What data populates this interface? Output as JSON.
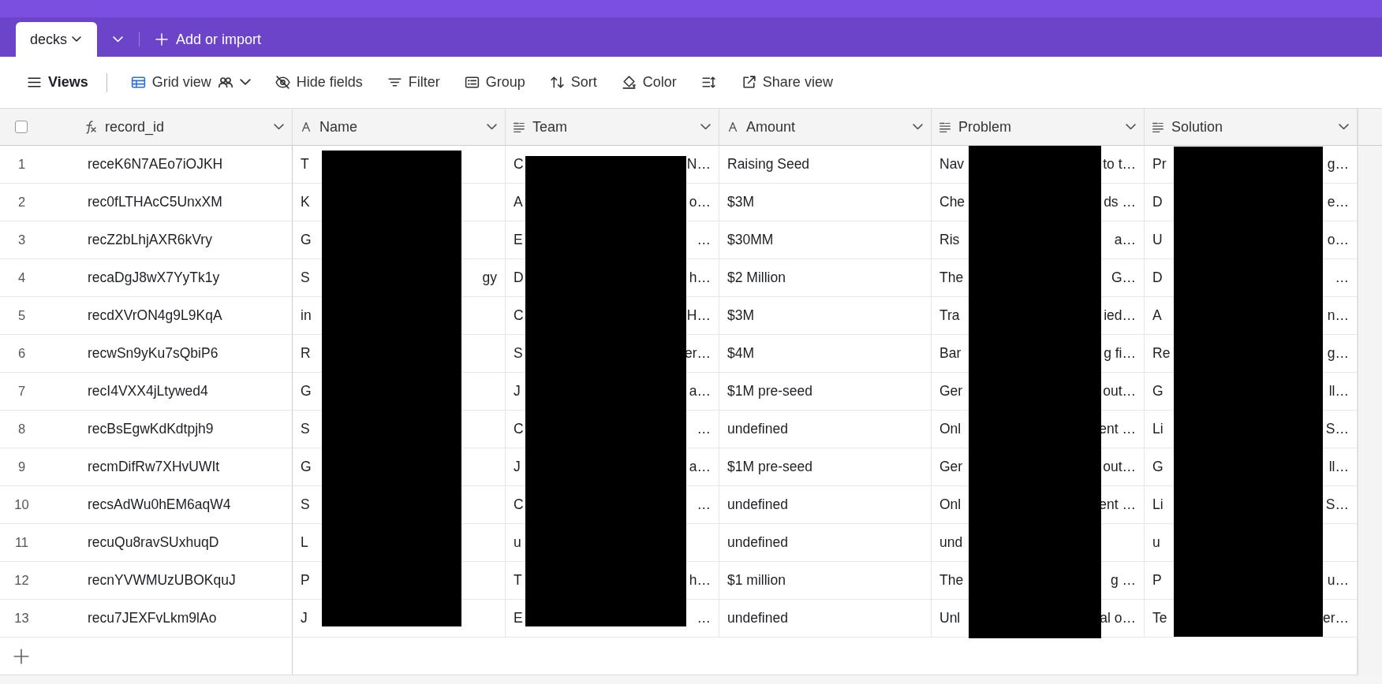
{
  "tabs": [
    {
      "label": "decks",
      "selected": true
    }
  ],
  "add_button": "Add or import",
  "toolbar": [
    {
      "label": "Views",
      "kind": "views"
    },
    {
      "label": "Grid view",
      "kind": "grid"
    },
    {
      "label": "Hide fields",
      "kind": "hide"
    },
    {
      "label": "Filter",
      "kind": "filter"
    },
    {
      "label": "Group",
      "kind": "group"
    },
    {
      "label": "Sort",
      "kind": "sort"
    },
    {
      "label": "Color",
      "kind": "color"
    },
    {
      "kind": "height"
    },
    {
      "label": "Share view",
      "kind": "share"
    }
  ],
  "table": {
    "select_all": {
      "checked": false
    },
    "columns": [
      {
        "label": "record_id",
        "kind": "formula"
      },
      {
        "label": "Name",
        "kind": "text"
      },
      {
        "label": "Team",
        "kind": "longtext"
      },
      {
        "label": "Amount",
        "kind": "text"
      },
      {
        "label": "Problem",
        "kind": "longtext"
      },
      {
        "label": "Solution",
        "kind": "longtext"
      }
    ],
    "rows": [
      {
        "number": "1",
        "record_id": "receK6N7AEo7iOJKH",
        "name": {
          "start": "T"
        },
        "team": {
          "start": "C",
          "end": "N…"
        },
        "amount": "Raising Seed",
        "problem": {
          "start": "Nav",
          "end": "to t…"
        },
        "solution": {
          "start": "Pr",
          "end": "g…"
        }
      },
      {
        "number": "2",
        "record_id": "rec0fLTHAcC5UnxXM",
        "name": {
          "start": "K"
        },
        "team": {
          "start": "A",
          "end": "o…"
        },
        "amount": "$3M",
        "problem": {
          "start": "Che",
          "end": "ds …"
        },
        "solution": {
          "start": "D",
          "end": "e…"
        }
      },
      {
        "number": "3",
        "record_id": "recZ2bLhjAXR6kVry",
        "name": {
          "start": "G"
        },
        "team": {
          "start": "E",
          "end": "…"
        },
        "amount": "$30MM",
        "problem": {
          "start": "Ris",
          "end": "a…"
        },
        "solution": {
          "start": "U",
          "end": "o…"
        }
      },
      {
        "number": "4",
        "record_id": "recaDgJ8wX7YyTk1y",
        "name": {
          "start": "S",
          "end": "gy"
        },
        "team": {
          "start": "D",
          "end": "h…"
        },
        "amount": "$2 Million",
        "problem": {
          "start": "The",
          "end": "G…"
        },
        "solution": {
          "start": "D",
          "end": "…"
        }
      },
      {
        "number": "5",
        "record_id": "recdXVrON4g9L9KqA",
        "name": {
          "start": "in"
        },
        "team": {
          "start": "C",
          "end": "H…"
        },
        "amount": "$3M",
        "problem": {
          "start": "Tra",
          "end": "ied…"
        },
        "solution": {
          "start": "A",
          "end": "n…"
        }
      },
      {
        "number": "6",
        "record_id": "recwSn9yKu7sQbiP6",
        "name": {
          "start": "R"
        },
        "team": {
          "start": "S",
          "end": "er…"
        },
        "amount": "$4M",
        "problem": {
          "start": "Bar",
          "end": "g fi…"
        },
        "solution": {
          "start": "Re",
          "end": "g…"
        }
      },
      {
        "number": "7",
        "record_id": "recI4VXX4jLtywed4",
        "name": {
          "start": "G"
        },
        "team": {
          "start": "J",
          "end": "a…"
        },
        "amount": "$1M pre-seed",
        "problem": {
          "start": "Ger",
          "end": "out…"
        },
        "solution": {
          "start": "G",
          "end": "ll…"
        }
      },
      {
        "number": "8",
        "record_id": "recBsEgwKdKdtpjh9",
        "name": {
          "start": "S"
        },
        "team": {
          "start": "C",
          "end": "…"
        },
        "amount": "undefined",
        "problem": {
          "start": "Onl",
          "end": "ent …"
        },
        "solution": {
          "start": "Li",
          "end": "S…"
        }
      },
      {
        "number": "9",
        "record_id": "recmDifRw7XHvUWIt",
        "name": {
          "start": "G"
        },
        "team": {
          "start": "J",
          "end": "a…"
        },
        "amount": "$1M pre-seed",
        "problem": {
          "start": "Ger",
          "end": "out…"
        },
        "solution": {
          "start": "G",
          "end": "ll…"
        }
      },
      {
        "number": "10",
        "record_id": "recsAdWu0hEM6aqW4",
        "name": {
          "start": "S"
        },
        "team": {
          "start": "C",
          "end": "…"
        },
        "amount": "undefined",
        "problem": {
          "start": "Onl",
          "end": "ent …"
        },
        "solution": {
          "start": "Li",
          "end": "S…"
        }
      },
      {
        "number": "11",
        "record_id": "recuQu8ravSUxhuqD",
        "name": {
          "start": "L"
        },
        "team": {
          "start": "u"
        },
        "amount": "undefined",
        "problem": {
          "start": "und"
        },
        "solution": {
          "start": "u"
        }
      },
      {
        "number": "12",
        "record_id": "recnYVWMUzUBOKquJ",
        "name": {
          "start": "P"
        },
        "team": {
          "start": "T",
          "end": "h…"
        },
        "amount": "$1 million",
        "problem": {
          "start": "The",
          "end": "g …"
        },
        "solution": {
          "start": "P",
          "end": "u…"
        }
      },
      {
        "number": "13",
        "record_id": "recu7JEXFvLkm9lAo",
        "name": {
          "start": "J"
        },
        "team": {
          "start": "E",
          "end": "…"
        },
        "amount": "undefined",
        "problem": {
          "start": "Unl",
          "end": "al o…"
        },
        "solution": {
          "start": "Te",
          "end": "er…"
        }
      }
    ]
  }
}
